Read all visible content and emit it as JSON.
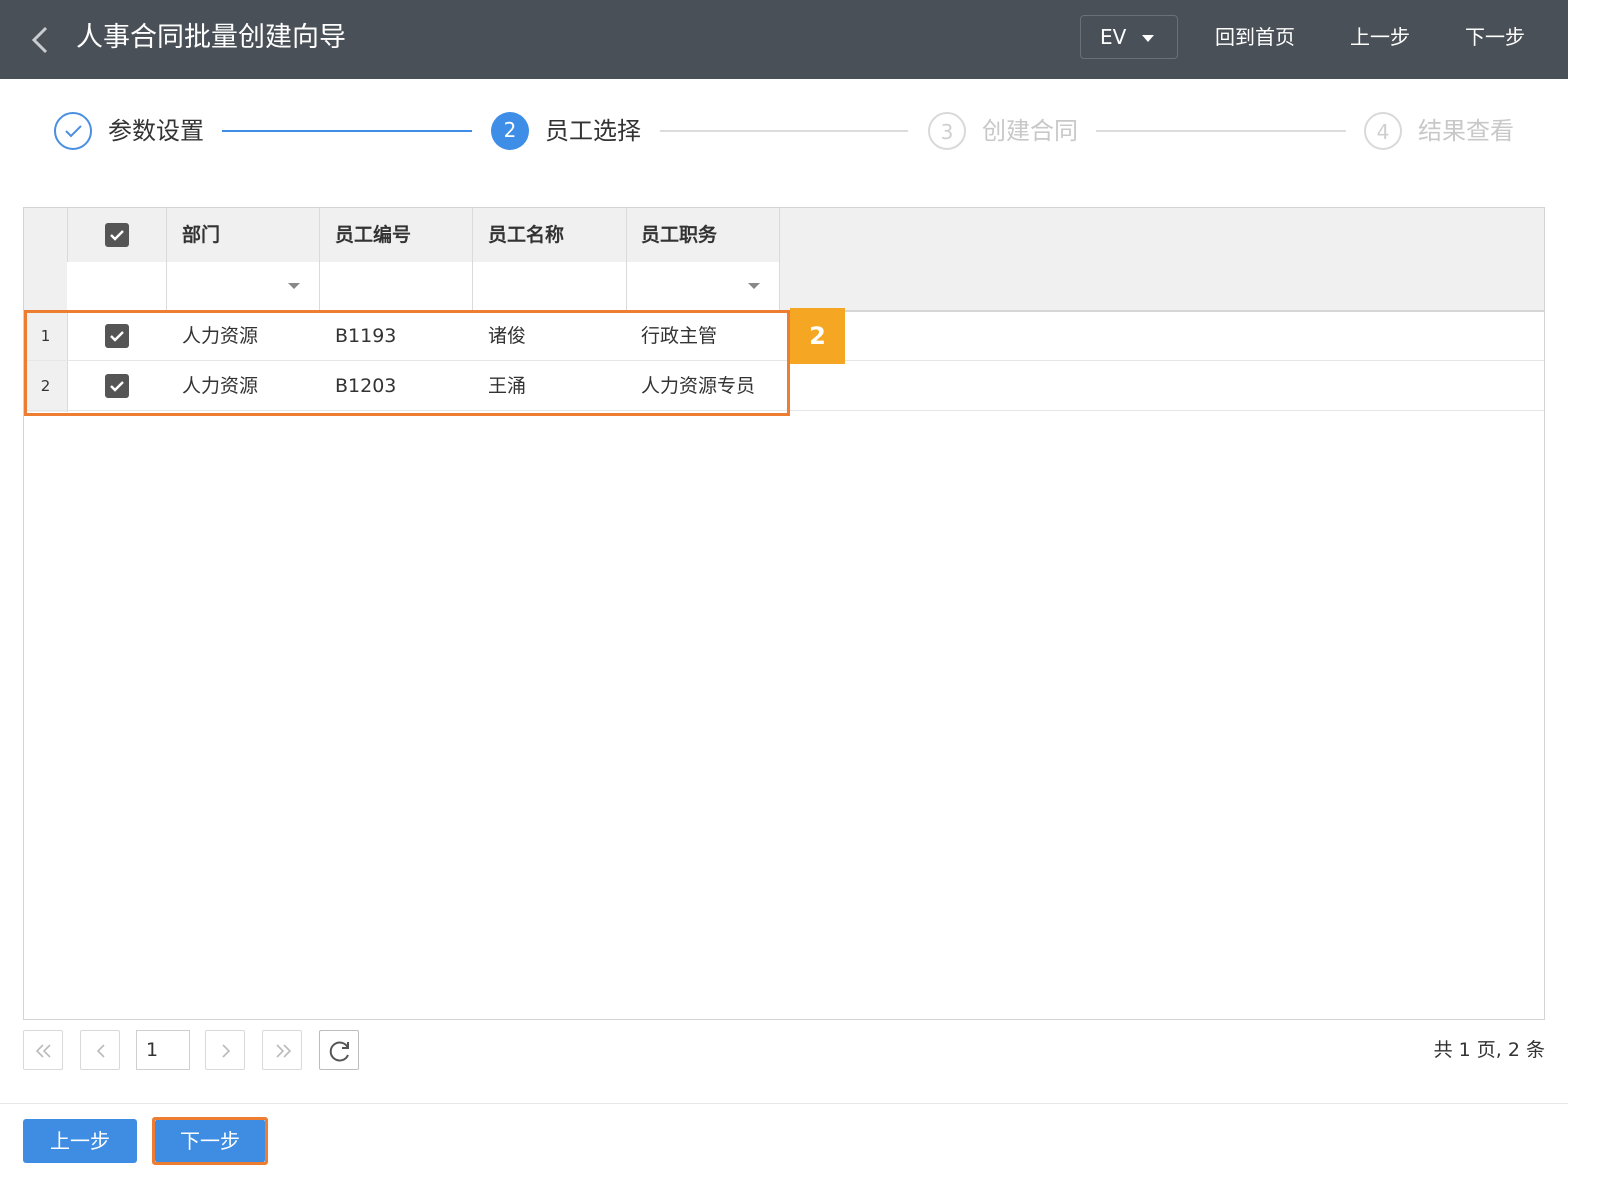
{
  "header": {
    "title": "人事合同批量创建向导",
    "lang_select": "EV",
    "home_link": "回到首页",
    "prev_link": "上一步",
    "next_link": "下一步"
  },
  "steps": [
    {
      "number": "",
      "label": "参数设置",
      "state": "done"
    },
    {
      "number": "2",
      "label": "员工选择",
      "state": "active"
    },
    {
      "number": "3",
      "label": "创建合同",
      "state": "todo"
    },
    {
      "number": "4",
      "label": "结果查看",
      "state": "todo"
    }
  ],
  "grid": {
    "columns": [
      "部门",
      "员工编号",
      "员工名称",
      "员工职务"
    ],
    "rows": [
      {
        "num": "1",
        "dept": "人力资源",
        "id": "B1193",
        "name": "诸俊",
        "title": "行政主管",
        "checked": true
      },
      {
        "num": "2",
        "dept": "人力资源",
        "id": "B1203",
        "name": "王涌",
        "title": "人力资源专员",
        "checked": true
      }
    ]
  },
  "annotation": {
    "badge": "2",
    "color": "#ed7d31",
    "badge_color": "#f5a623"
  },
  "pagination": {
    "page": "1",
    "total": "共 1 页, 2 条"
  },
  "footer": {
    "prev_button": "上一步",
    "next_button": "下一步"
  },
  "colors": {
    "header_bg": "#4a5057",
    "accent": "#3e8ee8"
  }
}
